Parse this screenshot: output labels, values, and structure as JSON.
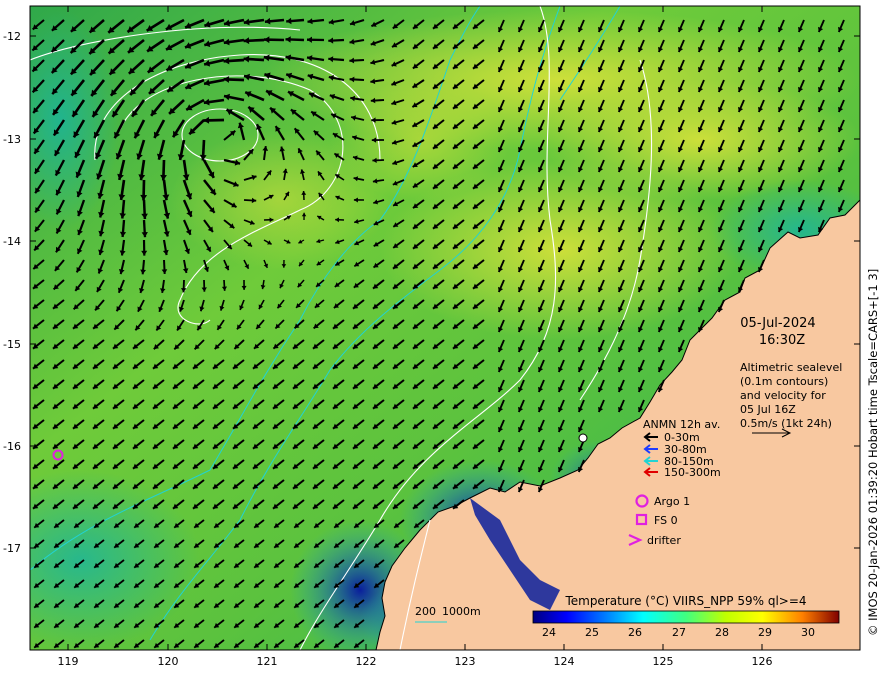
{
  "map": {
    "date": "05-Jul-2024",
    "time": "16:30Z",
    "description_lines": [
      "Altimetric sealevel",
      "(0.1m contours)",
      "and velocity for",
      "05 Jul 16Z",
      "0.5m/s (1kt 24h)"
    ],
    "lat_ticks": [
      "-12",
      "-13",
      "-14",
      "-15",
      "-16",
      "-17"
    ],
    "lon_ticks": [
      "119",
      "120",
      "121",
      "122",
      "123",
      "124",
      "125",
      "126"
    ],
    "colors": {
      "land": "#f8c8a0",
      "arrow": "#000000",
      "contour": "#ffffff",
      "isobath": "#22d3d3",
      "marker": "#e020e0"
    }
  },
  "legend": {
    "title": "ANMN 12h av.",
    "items": [
      {
        "label": "0-30m",
        "color": "#000000"
      },
      {
        "label": "30-80m",
        "color": "#1e3cff"
      },
      {
        "label": "80-150m",
        "color": "#22d3d3"
      },
      {
        "label": "150-300m",
        "color": "#e00000"
      }
    ],
    "markers": [
      {
        "label": "Argo 1",
        "symbol": "circle"
      },
      {
        "label": "FS 0",
        "symbol": "square"
      },
      {
        "label": "drifter",
        "symbol": "chevron"
      }
    ]
  },
  "colorbar": {
    "title": "Temperature (°C) VIIRS_NPP 59% ql>=4",
    "ticks": [
      "24",
      "25",
      "26",
      "27",
      "28",
      "29",
      "30"
    ]
  },
  "isobath_legend": {
    "label_200": "200",
    "label_1000": "1000m"
  },
  "credit": "© IMOS 20-Jan-2026 01:39:20 Hobart time Tscale=CARS+[-1 3]"
}
